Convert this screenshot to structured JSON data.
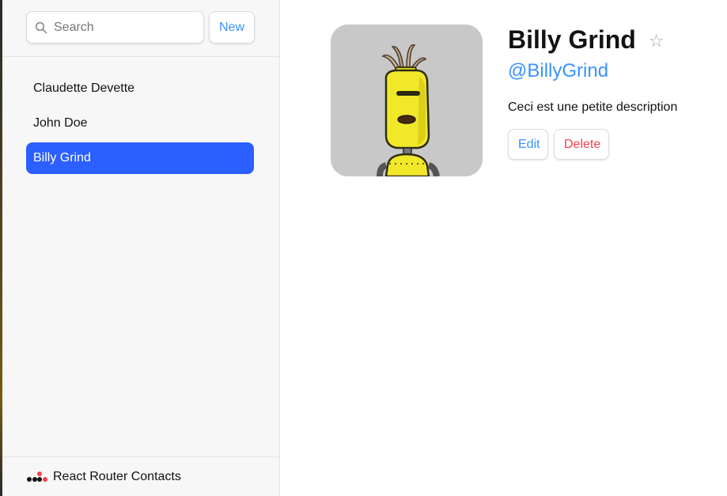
{
  "colors": {
    "accent": "#3992ff",
    "active_item_bg": "#2c5fff",
    "danger": "#f44250",
    "sidebar_bg": "#f7f7f7"
  },
  "sidebar": {
    "search": {
      "placeholder": "Search",
      "value": "",
      "icon": "search-icon"
    },
    "new_label": "New",
    "contacts": [
      {
        "name": "Claudette Devette",
        "active": false
      },
      {
        "name": "John Doe",
        "active": false
      },
      {
        "name": "Billy Grind",
        "active": true
      }
    ],
    "footer": {
      "logo_icon": "react-router-logo-icon",
      "label": "React Router Contacts"
    }
  },
  "contact": {
    "name": "Billy Grind",
    "favorite_icon": "star-outline-icon",
    "favorite_glyph": "☆",
    "handle": "@BillyGrind",
    "notes": "Ceci est une petite description",
    "avatar_icon": "robot-avatar-icon",
    "edit_label": "Edit",
    "delete_label": "Delete"
  }
}
